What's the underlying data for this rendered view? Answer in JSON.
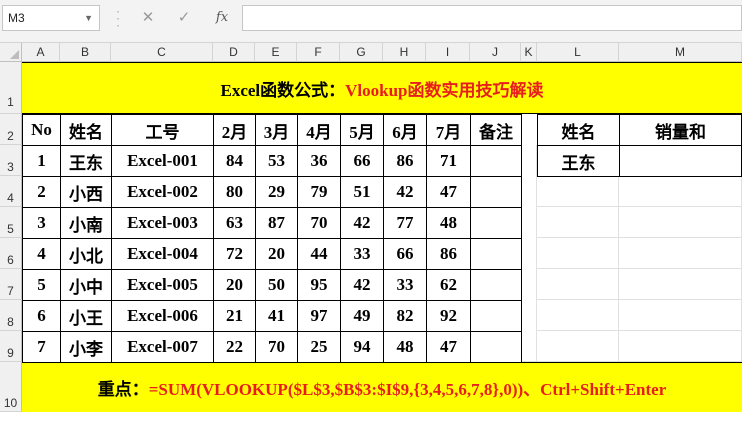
{
  "formula_bar": {
    "name_box": "M3",
    "fx_label": "fx",
    "formula": ""
  },
  "columns": [
    "A",
    "B",
    "C",
    "D",
    "E",
    "F",
    "G",
    "H",
    "I",
    "J",
    "K",
    "L",
    "M"
  ],
  "rows": [
    "1",
    "2",
    "3",
    "4",
    "5",
    "6",
    "7",
    "8",
    "9",
    "10"
  ],
  "title": {
    "part1": "Excel函数公式：",
    "part2": "Vlookup函数实用技巧解读"
  },
  "headers": [
    "No",
    "姓名",
    "工号",
    "2月",
    "3月",
    "4月",
    "5月",
    "6月",
    "7月",
    "备注"
  ],
  "lookup_headers": [
    "姓名",
    "销量和"
  ],
  "lookup_values": [
    "王东",
    ""
  ],
  "data_rows": [
    [
      "1",
      "王东",
      "Excel-001",
      "84",
      "53",
      "36",
      "66",
      "86",
      "71",
      ""
    ],
    [
      "2",
      "小西",
      "Excel-002",
      "80",
      "29",
      "79",
      "51",
      "42",
      "47",
      ""
    ],
    [
      "3",
      "小南",
      "Excel-003",
      "63",
      "87",
      "70",
      "42",
      "77",
      "48",
      ""
    ],
    [
      "4",
      "小北",
      "Excel-004",
      "72",
      "20",
      "44",
      "33",
      "66",
      "86",
      ""
    ],
    [
      "5",
      "小中",
      "Excel-005",
      "20",
      "50",
      "95",
      "42",
      "33",
      "62",
      ""
    ],
    [
      "6",
      "小王",
      "Excel-006",
      "21",
      "41",
      "97",
      "49",
      "82",
      "92",
      ""
    ],
    [
      "7",
      "小李",
      "Excel-007",
      "22",
      "70",
      "25",
      "94",
      "48",
      "47",
      ""
    ]
  ],
  "footer": {
    "label": "重点：",
    "formula": "=SUM(VLOOKUP($L$3,$B$3:$I$9,{3,4,5,6,7,8},0))、Ctrl+Shift+Enter"
  },
  "colors": {
    "highlight": "#ffff00",
    "accent_red": "#e81e1e"
  }
}
